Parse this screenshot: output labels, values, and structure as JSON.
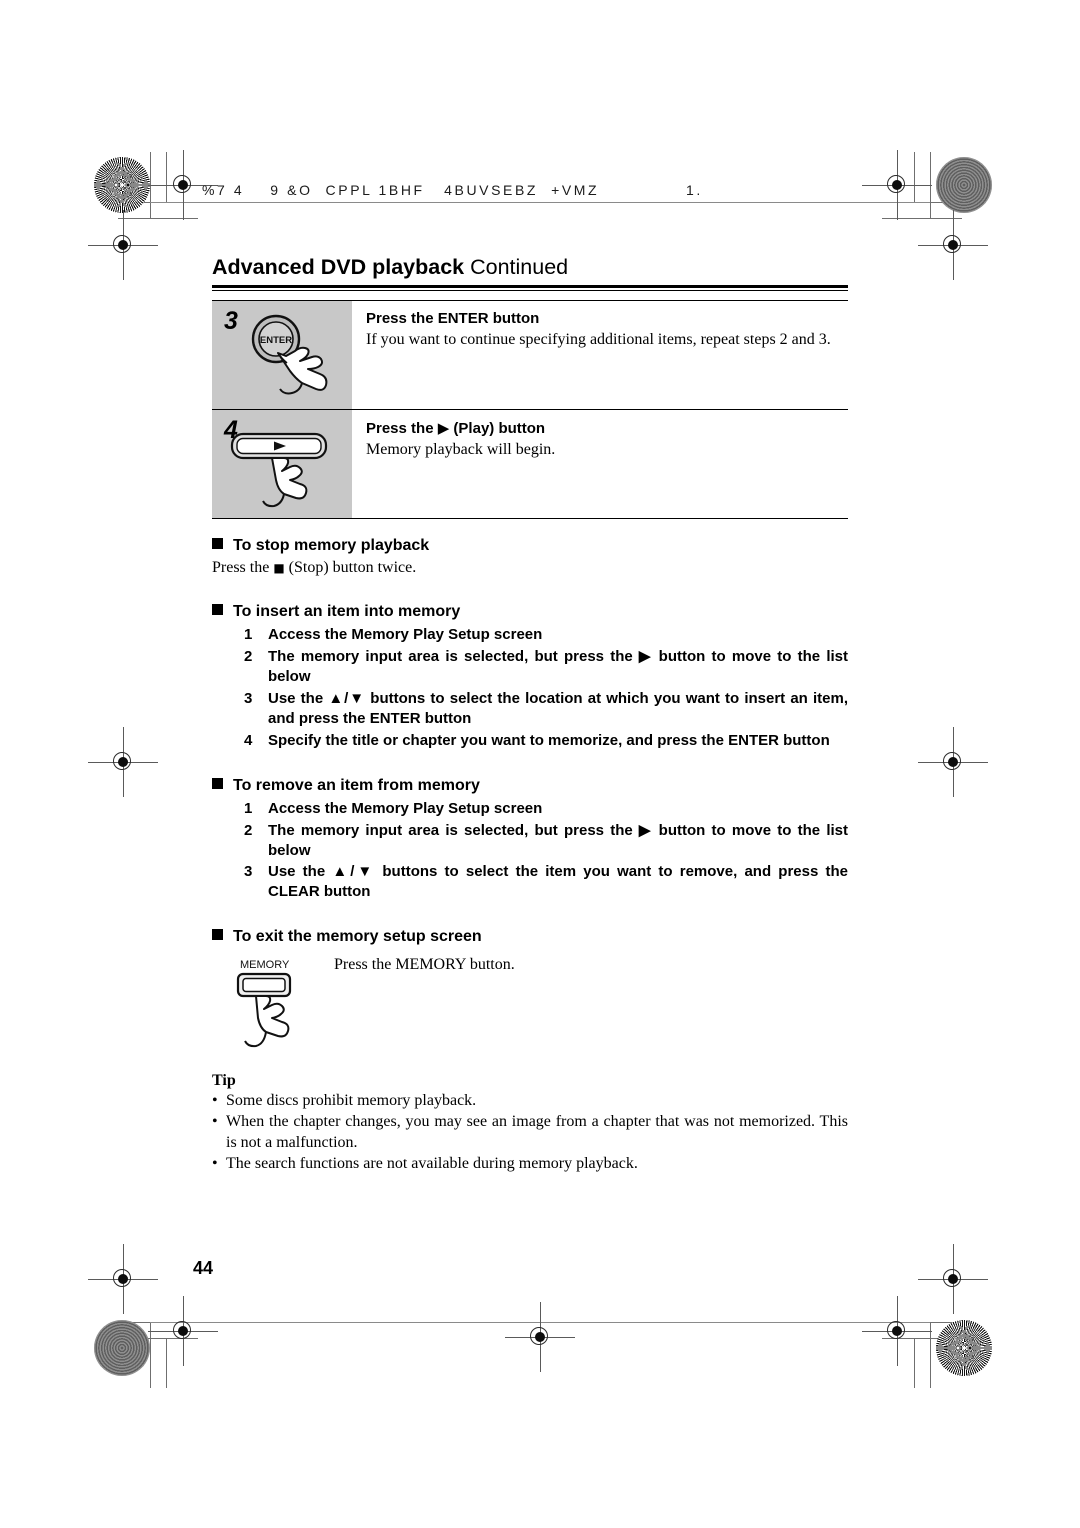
{
  "scan_header": {
    "left_text": "%7 4    9 &O  CPPL 1BHF   4BUVSEBZ  +VMZ",
    "right_text": "1."
  },
  "title": {
    "strong": "Advanced DVD playback",
    "light": "Continued"
  },
  "steps": [
    {
      "number": "3",
      "icon": "enter-button-press",
      "heading": "Press the ENTER button",
      "text": "If you want to continue specifying additional items, repeat steps 2 and 3.",
      "button_label": "ENTER"
    },
    {
      "number": "4",
      "icon": "play-button-press",
      "heading": "Press the ▶ (Play) button",
      "heading_prefix": "Press the ",
      "heading_glyph": "▶",
      "heading_suffix": " (Play) button",
      "text": "Memory playback will begin."
    }
  ],
  "sections": [
    {
      "heading": "To stop memory playback",
      "body_prefix": "Press the ",
      "body_glyph": "■",
      "body_suffix": " (Stop) button twice."
    },
    {
      "heading": "To insert an item into memory",
      "items": [
        {
          "n": "1",
          "text": "Access the Memory Play Setup screen"
        },
        {
          "n": "2",
          "text": "The memory input area is selected, but press the ▶ button to move to the list below"
        },
        {
          "n": "3",
          "text": "Use the ▲/▼ buttons to select the location at which you want to insert an item, and press the ENTER button"
        },
        {
          "n": "4",
          "text": "Specify the title or chapter you want to memorize, and press the ENTER button"
        }
      ]
    },
    {
      "heading": "To remove an item from memory",
      "items": [
        {
          "n": "1",
          "text": "Access the Memory Play Setup screen"
        },
        {
          "n": "2",
          "text": "The memory input area is selected, but press the ▶ button to move to the list below"
        },
        {
          "n": "3",
          "text": "Use the ▲/▼ buttons to select the item you want to remove, and press the CLEAR button"
        }
      ]
    },
    {
      "heading": "To exit the memory setup screen",
      "memory_button_label": "MEMORY",
      "memory_text": "Press the MEMORY button."
    }
  ],
  "tip": {
    "heading": "Tip",
    "items": [
      "Some discs prohibit memory playback.",
      "When the chapter changes, you may see an image from a chapter that was not memorized. This is not a malfunction.",
      "The search functions are not available during memory playback."
    ]
  },
  "page_number": "44",
  "colors": {
    "step_panel_gray": "#c8c8c8",
    "ink": "#000000",
    "mark_gray": "#6f6f6f"
  }
}
